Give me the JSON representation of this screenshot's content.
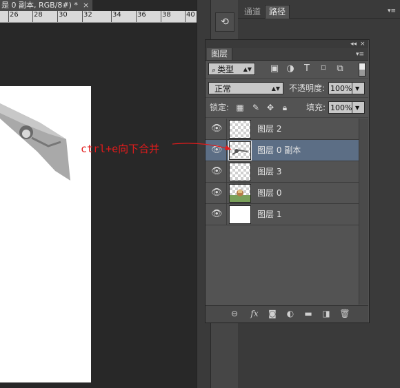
{
  "document": {
    "tab_title": "是 0 副本, RGB/8#) *",
    "close": "×",
    "ruler_labels": [
      "26",
      "28",
      "30",
      "32",
      "34",
      "36",
      "38",
      "40"
    ]
  },
  "dock": {
    "history_icon": "history-icon",
    "tabs": [
      "通道",
      "路径"
    ],
    "menu": "▾≡"
  },
  "layers_panel": {
    "collapse": "◂◂",
    "close": "×",
    "tab": "图层",
    "menu": "▾≡",
    "filter": {
      "kind": "类型",
      "icons": [
        "image-filter-icon",
        "adjustment-filter-icon",
        "type-filter-icon",
        "shape-filter-icon",
        "smart-object-filter-icon"
      ]
    },
    "blend_mode": "正常",
    "opacity_label": "不透明度:",
    "opacity": "100%",
    "lock_label": "锁定:",
    "fill_label": "填充:",
    "fill": "100%",
    "layers": [
      {
        "name": "图层 2",
        "visible": true,
        "thumb": "transparent",
        "selected": false
      },
      {
        "name": "图层 0 副本",
        "visible": true,
        "thumb": "figure",
        "selected": true
      },
      {
        "name": "图层 3",
        "visible": true,
        "thumb": "transparent",
        "selected": false
      },
      {
        "name": "图层 0",
        "visible": true,
        "thumb": "landscape",
        "selected": false
      },
      {
        "name": "图层 1",
        "visible": true,
        "thumb": "white",
        "selected": false
      }
    ],
    "footer_icons": [
      "link-icon",
      "fx-icon",
      "mask-icon",
      "adjustment-icon",
      "folder-icon",
      "new-layer-icon",
      "trash-icon"
    ],
    "fx_label": "fx"
  },
  "annotation": {
    "text": "ctrl+e向下合并",
    "color": "#e21b1b"
  },
  "colors": {
    "selected_row": "#5c6e85",
    "panel_bg": "#535353",
    "workspace_bg": "#282828"
  }
}
